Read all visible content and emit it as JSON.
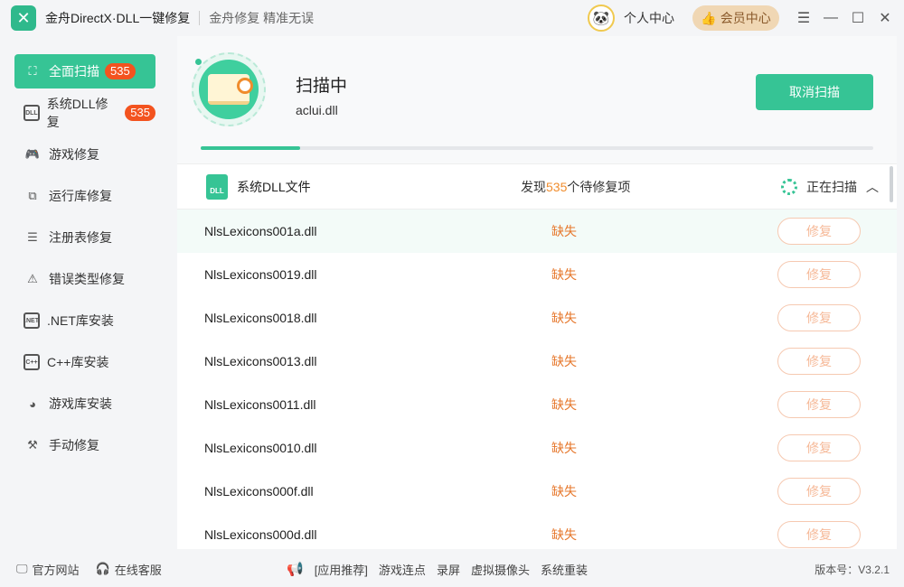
{
  "app": {
    "title": "金舟DirectX·DLL一键修复",
    "slogan": "金舟修复 精准无误"
  },
  "header": {
    "user_center": "个人中心",
    "vip_label": "会员中心",
    "controls": [
      "menu-icon",
      "minimize-icon",
      "maximize-icon",
      "close-icon"
    ]
  },
  "sidebar": {
    "items": [
      {
        "label": "全面扫描",
        "badge": "535",
        "icon": "scan-icon"
      },
      {
        "label": "系统DLL修复",
        "badge": "535",
        "icon": "dll-icon"
      },
      {
        "label": "游戏修复",
        "icon": "gamepad-icon"
      },
      {
        "label": "运行库修复",
        "icon": "runtime-icon"
      },
      {
        "label": "注册表修复",
        "icon": "list-icon"
      },
      {
        "label": "错误类型修复",
        "icon": "warning-icon"
      },
      {
        "label": ".NET库安装",
        "icon": "dotnet-icon"
      },
      {
        "label": "C++库安装",
        "icon": "cpp-icon"
      },
      {
        "label": "游戏库安装",
        "icon": "pacman-icon"
      },
      {
        "label": "手动修复",
        "icon": "tools-icon"
      }
    ]
  },
  "scan": {
    "status": "扫描中",
    "current_file": "aclui.dll",
    "cancel_label": "取消扫描",
    "progress": 0.148
  },
  "section": {
    "title": "系统DLL文件",
    "found_prefix": "发现",
    "found_count": "535",
    "found_suffix": "个待修复项",
    "scanning_label": "正在扫描"
  },
  "rows": [
    {
      "name": "NlsLexicons001a.dll",
      "status": "缺失",
      "action": "修复"
    },
    {
      "name": "NlsLexicons0019.dll",
      "status": "缺失",
      "action": "修复"
    },
    {
      "name": "NlsLexicons0018.dll",
      "status": "缺失",
      "action": "修复"
    },
    {
      "name": "NlsLexicons0013.dll",
      "status": "缺失",
      "action": "修复"
    },
    {
      "name": "NlsLexicons0011.dll",
      "status": "缺失",
      "action": "修复"
    },
    {
      "name": "NlsLexicons0010.dll",
      "status": "缺失",
      "action": "修复"
    },
    {
      "name": "NlsLexicons000f.dll",
      "status": "缺失",
      "action": "修复"
    },
    {
      "name": "NlsLexicons000d.dll",
      "status": "缺失",
      "action": "修复"
    }
  ],
  "footer": {
    "official_site": "官方网站",
    "online_service": "在线客服",
    "promo_links": [
      "[应用推荐]",
      "游戏连点",
      "录屏",
      "虚拟摄像头",
      "系统重装"
    ],
    "version": "版本号：V3.2.1"
  },
  "colors": {
    "accent": "#36c495",
    "badge": "#f3531f",
    "missing": "#e6772b"
  }
}
